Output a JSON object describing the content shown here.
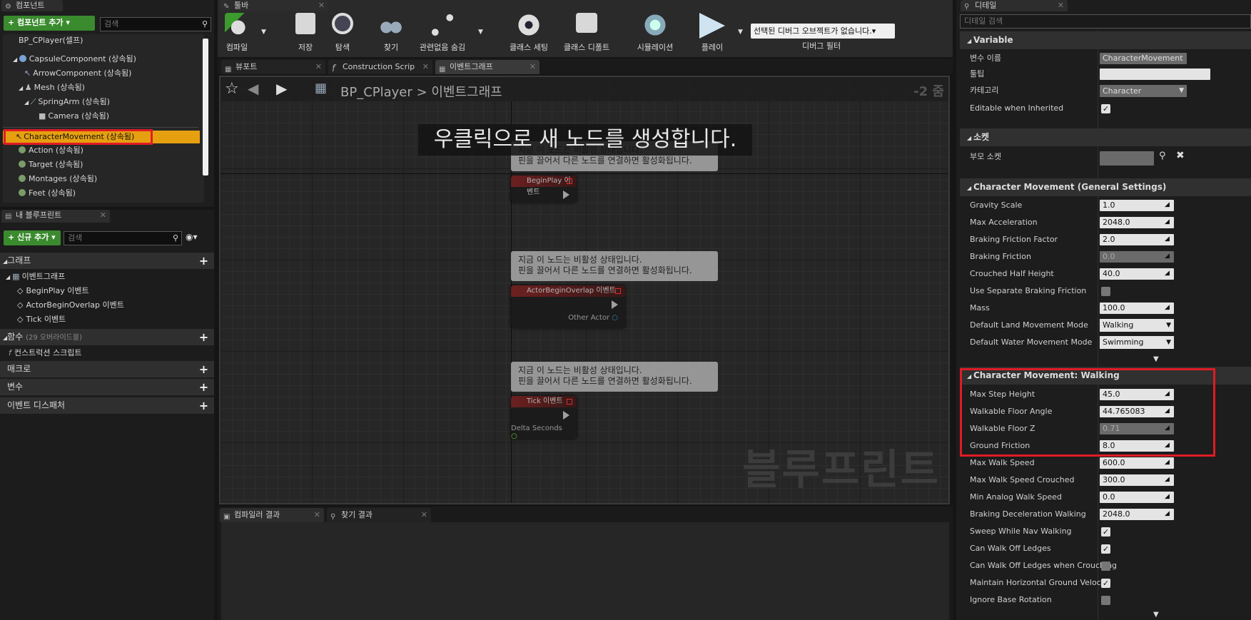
{
  "components": {
    "tab": "컴포넌트",
    "add_label": "+ 컴포넌트 추가 ▾",
    "search_placeholder": "검색",
    "items": [
      {
        "label": "BP_CPlayer(셀프)"
      },
      {
        "label": "CapsuleComponent (상속됨)"
      },
      {
        "label": "ArrowComponent (상속됨)"
      },
      {
        "label": "Mesh (상속됨)"
      },
      {
        "label": "SpringArm (상속됨)"
      },
      {
        "label": "Camera (상속됨)"
      },
      {
        "label": "CharacterMovement (상속됨)"
      },
      {
        "label": "Action (상속됨)"
      },
      {
        "label": "Target (상속됨)"
      },
      {
        "label": "Montages (상속됨)"
      },
      {
        "label": "Feet (상속됨)"
      }
    ]
  },
  "blueprint": {
    "tab": "내 블루프린트",
    "add_label": "+ 신규 추가 ▾",
    "search_placeholder": "검색",
    "graph_section": "그래프",
    "event_graph": "이벤트그래프",
    "events": [
      "BeginPlay 이벤트",
      "ActorBeginOverlap 이벤트",
      "Tick 이벤트"
    ],
    "functions_section": "함수",
    "functions_override": "(29 오버라이드블)",
    "construction": "컨스트럭션 스크립트",
    "macros": "매크로",
    "variables": "변수",
    "dispatchers": "이벤트 디스패처"
  },
  "toolbar": {
    "tab": "툴바",
    "buttons": [
      {
        "label": "컴파일"
      },
      {
        "label": "저장"
      },
      {
        "label": "탐색"
      },
      {
        "label": "찾기"
      },
      {
        "label": "관련없음 숨김"
      },
      {
        "label": "클래스 세팅"
      },
      {
        "label": "클래스 디폴트"
      },
      {
        "label": "시뮬레이션"
      },
      {
        "label": "플레이"
      }
    ],
    "debug_select": "선택된 디버그 오브젝트가 없습니다.▾",
    "debug_filter": "디버그 필터"
  },
  "editor_tabs": [
    "뷰포트",
    "Construction Scrip",
    "이벤트그래프"
  ],
  "graph": {
    "breadcrumb_root": "BP_CPlayer",
    "breadcrumb_sep": ">",
    "breadcrumb_current": "이벤트그래프",
    "zoom": "-2 줌",
    "hint": "우클릭으로 새 노드를 생성합니다.",
    "comment_line1": "지금 이 노드는 비활성 상태입니다.",
    "comment_line2": "핀을 끌어서 다른 노드를 연결하면 활성화됩니다.",
    "node1": "BeginPlay 이벤트",
    "node2": "ActorBeginOverlap 이벤트",
    "node2_pin": "Other Actor",
    "node3": "Tick 이벤트",
    "node3_pin": "Delta Seconds",
    "watermark": "블루프린트"
  },
  "bottom_tabs": [
    "컴파일러 결과",
    "찾기 결과"
  ],
  "details": {
    "tab": "디테일",
    "search_placeholder": "디테일 검색",
    "variable_section": "Variable",
    "var_name_label": "변수 이름",
    "var_name_value": "CharacterMovement",
    "tooltip_label": "툴팁",
    "category_label": "카테고리",
    "category_value": "Character",
    "editable_label": "Editable when Inherited",
    "socket_section": "소켓",
    "parent_socket_label": "부모 소켓",
    "general_section": "Character Movement (General Settings)",
    "general": [
      {
        "label": "Gravity Scale",
        "value": "1.0"
      },
      {
        "label": "Max Acceleration",
        "value": "2048.0"
      },
      {
        "label": "Braking Friction Factor",
        "value": "2.0"
      },
      {
        "label": "Braking Friction",
        "value": "0.0"
      },
      {
        "label": "Crouched Half Height",
        "value": "40.0"
      },
      {
        "label": "Use Separate Braking Friction",
        "value": ""
      },
      {
        "label": "Mass",
        "value": "100.0"
      },
      {
        "label": "Default Land Movement Mode",
        "value": "Walking"
      },
      {
        "label": "Default Water Movement Mode",
        "value": "Swimming"
      }
    ],
    "walking_section": "Character Movement: Walking",
    "walking": [
      {
        "label": "Max Step Height",
        "value": "45.0"
      },
      {
        "label": "Walkable Floor Angle",
        "value": "44.765083"
      },
      {
        "label": "Walkable Floor Z",
        "value": "0.71"
      },
      {
        "label": "Ground Friction",
        "value": "8.0"
      },
      {
        "label": "Max Walk Speed",
        "value": "600.0"
      },
      {
        "label": "Max Walk Speed Crouched",
        "value": "300.0"
      },
      {
        "label": "Min Analog Walk Speed",
        "value": "0.0"
      },
      {
        "label": "Braking Deceleration Walking",
        "value": "2048.0"
      },
      {
        "label": "Sweep While Nav Walking",
        "value": ""
      },
      {
        "label": "Can Walk Off Ledges",
        "value": ""
      },
      {
        "label": "Can Walk Off Ledges when Crouching",
        "value": ""
      },
      {
        "label": "Maintain Horizontal Ground Velocity",
        "value": ""
      },
      {
        "label": "Ignore Base Rotation",
        "value": ""
      }
    ]
  },
  "colors": {
    "highlight": "#e6a00f",
    "red_box": "#e01b24",
    "accent_green": "#3a8a2e"
  }
}
